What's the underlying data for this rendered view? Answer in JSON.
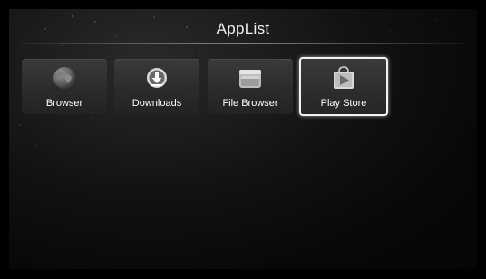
{
  "header": {
    "title": "AppList"
  },
  "apps": [
    {
      "label": "Browser",
      "icon": "globe-icon"
    },
    {
      "label": "Downloads",
      "icon": "download-icon"
    },
    {
      "label": "File Browser",
      "icon": "folder-icon"
    },
    {
      "label": "Play Store",
      "icon": "play-store-icon",
      "selected": true
    }
  ],
  "colors": {
    "background": "#000000",
    "tile": "#2f2f2f",
    "selection": "#f2f2f2",
    "text": "#ffffff"
  }
}
